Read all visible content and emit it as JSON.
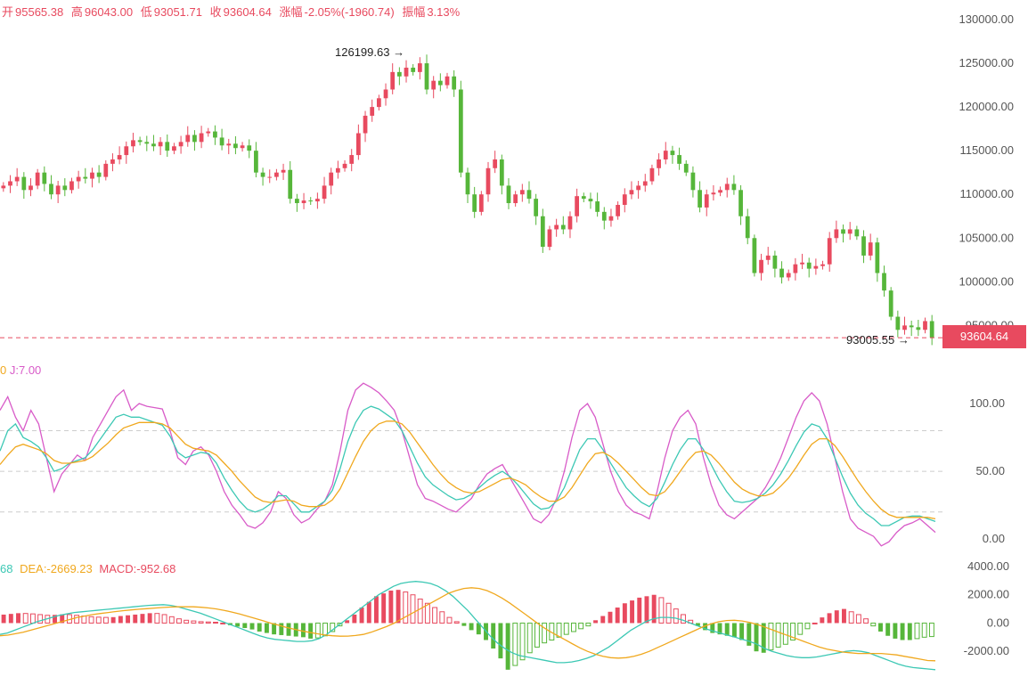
{
  "header": {
    "open_label": "开",
    "open": "95565.38",
    "high_label": "高",
    "high": "96043.00",
    "low_label": "低",
    "low": "93051.71",
    "close_label": "收",
    "close": "93604.64",
    "change_label": "涨幅",
    "change": "-2.05%(-1960.74)",
    "amp_label": "振幅",
    "amp": "3.13%"
  },
  "annotations": {
    "max": "126199.63 →",
    "min": "93005.55 →"
  },
  "price_tag": "93604.64",
  "kdj_legend": {
    "j": "J:7.00"
  },
  "macd_legend": {
    "dif_tail": "68",
    "dea": "DEA:-2669.23",
    "macd": "MACD:-952.68"
  },
  "colors": {
    "up": "#e84a5f",
    "down": "#56b63a",
    "k": "#3cc8b4",
    "d": "#f0a81e",
    "j": "#d85bc8",
    "grid": "#cccccc"
  },
  "chart_data": [
    {
      "type": "candlestick",
      "title": "",
      "ylim": [
        93000,
        130000
      ],
      "y_ticks": [
        "130000.00",
        "125000.00",
        "120000.00",
        "115000.00",
        "110000.00",
        "105000.00",
        "100000.00",
        "95000.00"
      ],
      "last_price": 93604.64,
      "max_label": 126199.63,
      "min_label": 93005.55,
      "close_series": [
        111000,
        111500,
        112000,
        110500,
        111000,
        112500,
        111200,
        110000,
        111000,
        110500,
        111500,
        112000,
        111800,
        112500,
        112000,
        113500,
        114000,
        114500,
        115500,
        116200,
        116000,
        115800,
        115500,
        116000,
        115000,
        115500,
        116000,
        116800,
        116000,
        117000,
        117200,
        116500,
        115600,
        115800,
        115300,
        115600,
        115000,
        112500,
        112000,
        112000,
        112500,
        112800,
        109500,
        109000,
        109300,
        109200,
        109500,
        111000,
        112500,
        113000,
        113500,
        114500,
        117000,
        119000,
        120000,
        121000,
        122000,
        124000,
        123500,
        124500,
        124000,
        125000,
        122000,
        123000,
        122500,
        123500,
        122000,
        112500,
        110000,
        108000,
        110000,
        113000,
        114000,
        111000,
        109000,
        110000,
        110500,
        109500,
        107500,
        104000,
        106000,
        106500,
        106000,
        107500,
        109800,
        109500,
        109200,
        108000,
        107000,
        107500,
        108800,
        110000,
        110500,
        111000,
        111500,
        113000,
        114000,
        115000,
        114500,
        113500,
        112500,
        110500,
        108500,
        110000,
        110200,
        110500,
        111200,
        110500,
        107500,
        105000,
        101000,
        102500,
        103000,
        101500,
        100500,
        101000,
        102000,
        102200,
        101500,
        101800,
        102000,
        105000,
        106000,
        105500,
        106000,
        105200,
        103000,
        104500,
        101000,
        99000,
        96000,
        94500,
        95000,
        94800,
        94500,
        95500,
        93604.64
      ]
    },
    {
      "type": "line",
      "title": "KDJ",
      "ylim": [
        -15,
        125
      ],
      "y_ticks": [
        "100.00",
        "50.00",
        "0.00"
      ],
      "reference_lines": [
        80,
        50,
        20
      ],
      "series": [
        {
          "name": "J",
          "values": [
            95,
            105,
            90,
            80,
            95,
            85,
            60,
            35,
            48,
            55,
            62,
            58,
            75,
            85,
            95,
            105,
            110,
            95,
            100,
            98,
            97,
            96,
            80,
            60,
            55,
            65,
            68,
            62,
            50,
            35,
            25,
            18,
            10,
            8,
            12,
            20,
            35,
            30,
            18,
            12,
            15,
            22,
            28,
            40,
            65,
            95,
            110,
            115,
            112,
            108,
            102,
            95,
            80,
            60,
            40,
            30,
            28,
            25,
            22,
            20,
            25,
            30,
            40,
            48,
            52,
            55,
            45,
            35,
            25,
            15,
            12,
            18,
            30,
            50,
            75,
            95,
            100,
            90,
            70,
            50,
            35,
            25,
            20,
            18,
            15,
            35,
            60,
            80,
            90,
            95,
            85,
            60,
            40,
            25,
            18,
            15,
            20,
            25,
            30,
            38,
            48,
            60,
            75,
            90,
            102,
            108,
            102,
            85,
            60,
            35,
            15,
            8,
            5,
            2,
            -5,
            -2,
            5,
            10,
            12,
            15,
            10,
            5
          ]
        },
        {
          "name": "K",
          "values": [
            65,
            80,
            85,
            75,
            72,
            68,
            60,
            50,
            52,
            56,
            58,
            60,
            66,
            74,
            82,
            90,
            92,
            90,
            90,
            88,
            86,
            84,
            76,
            64,
            60,
            62,
            64,
            63,
            56,
            45,
            36,
            28,
            22,
            20,
            22,
            26,
            32,
            32,
            26,
            20,
            20,
            24,
            28,
            36,
            52,
            72,
            86,
            95,
            98,
            96,
            92,
            88,
            80,
            68,
            56,
            46,
            40,
            36,
            32,
            29,
            30,
            33,
            38,
            43,
            47,
            50,
            46,
            40,
            33,
            26,
            22,
            23,
            28,
            38,
            52,
            66,
            74,
            74,
            66,
            56,
            47,
            38,
            32,
            27,
            24,
            30,
            42,
            55,
            66,
            74,
            74,
            66,
            55,
            44,
            35,
            28,
            27,
            28,
            30,
            34,
            40,
            48,
            58,
            69,
            79,
            85,
            83,
            74,
            60,
            46,
            34,
            25,
            19,
            15,
            10,
            10,
            13,
            16,
            17,
            17,
            15,
            13
          ]
        },
        {
          "name": "D",
          "values": [
            55,
            62,
            68,
            70,
            68,
            66,
            63,
            58,
            56,
            56,
            57,
            58,
            61,
            66,
            71,
            77,
            82,
            84,
            86,
            86,
            86,
            85,
            82,
            76,
            70,
            67,
            66,
            65,
            62,
            56,
            50,
            43,
            37,
            31,
            28,
            27,
            28,
            29,
            28,
            25,
            24,
            24,
            25,
            29,
            37,
            49,
            61,
            72,
            80,
            85,
            87,
            87,
            85,
            79,
            71,
            63,
            55,
            48,
            42,
            38,
            35,
            34,
            35,
            38,
            41,
            44,
            45,
            43,
            40,
            35,
            31,
            28,
            28,
            31,
            38,
            47,
            56,
            63,
            64,
            61,
            56,
            50,
            44,
            38,
            33,
            32,
            35,
            42,
            50,
            58,
            64,
            65,
            62,
            56,
            49,
            42,
            37,
            34,
            32,
            32,
            34,
            39,
            45,
            53,
            62,
            70,
            74,
            74,
            69,
            61,
            52,
            43,
            35,
            28,
            22,
            18,
            16,
            16,
            16,
            16,
            16,
            15
          ]
        }
      ]
    },
    {
      "type": "bar+line",
      "title": "MACD",
      "ylim": [
        -3500,
        4000
      ],
      "y_ticks": [
        "4000.00",
        "2000.00",
        "0.00",
        "-2000.00"
      ],
      "series": [
        {
          "name": "MACD",
          "values": [
            600,
            650,
            700,
            680,
            650,
            600,
            550,
            580,
            620,
            600,
            550,
            500,
            450,
            420,
            400,
            420,
            500,
            550,
            600,
            650,
            700,
            680,
            600,
            450,
            300,
            200,
            150,
            100,
            80,
            60,
            0,
            -150,
            -250,
            -350,
            -450,
            -600,
            -700,
            -800,
            -850,
            -900,
            -950,
            -1000,
            -1100,
            -1050,
            -900,
            -600,
            -200,
            200,
            600,
            1100,
            1500,
            1900,
            2100,
            2300,
            2350,
            2200,
            2000,
            1700,
            1400,
            1100,
            800,
            400,
            100,
            -200,
            -500,
            -800,
            -1200,
            -1800,
            -2500,
            -3300,
            -3000,
            -2600,
            -2100,
            -1700,
            -1400,
            -1200,
            -1000,
            -800,
            -600,
            -400,
            -200,
            200,
            500,
            800,
            1100,
            1400,
            1600,
            1800,
            1900,
            2000,
            1800,
            1400,
            1000,
            600,
            200,
            -200,
            -500,
            -700,
            -800,
            -900,
            -1000,
            -1200,
            -1600,
            -2000,
            -2100,
            -1900,
            -1700,
            -1500,
            -1200,
            -800,
            -400,
            0,
            400,
            700,
            900,
            1000,
            800,
            600,
            300,
            -200,
            -600,
            -900,
            -1100,
            -1200,
            -1200,
            -1100,
            -1000,
            -952.68
          ]
        },
        {
          "name": "DIF",
          "values": [
            -800,
            -700,
            -500,
            -300,
            -100,
            100,
            250,
            400,
            550,
            650,
            750,
            800,
            850,
            900,
            950,
            1000,
            1050,
            1100,
            1150,
            1200,
            1250,
            1280,
            1300,
            1250,
            1150,
            1000,
            850,
            700,
            500,
            300,
            100,
            -100,
            -300,
            -500,
            -700,
            -900,
            -1050,
            -1150,
            -1200,
            -1250,
            -1300,
            -1300,
            -1250,
            -1100,
            -800,
            -400,
            0,
            400,
            800,
            1200,
            1600,
            2000,
            2300,
            2600,
            2800,
            2900,
            2950,
            2900,
            2800,
            2600,
            2300,
            1900,
            1400,
            900,
            300,
            -300,
            -900,
            -1400,
            -1800,
            -2100,
            -2300,
            -2400,
            -2500,
            -2600,
            -2700,
            -2800,
            -2800,
            -2750,
            -2650,
            -2500,
            -2300,
            -2000,
            -1700,
            -1300,
            -900,
            -500,
            -200,
            100,
            300,
            400,
            400,
            350,
            200,
            0,
            -200,
            -400,
            -550,
            -700,
            -850,
            -1000,
            -1150,
            -1300,
            -1500,
            -1800,
            -2000,
            -2150,
            -2300,
            -2400,
            -2450,
            -2450,
            -2400,
            -2300,
            -2200,
            -2100,
            -2000,
            -1950,
            -2000,
            -2100,
            -2300,
            -2500,
            -2700,
            -2900,
            -3050,
            -3150,
            -3200,
            -3250,
            -3300
          ]
        },
        {
          "name": "DEA",
          "values": [
            -900,
            -850,
            -750,
            -650,
            -500,
            -350,
            -200,
            -50,
            100,
            250,
            400,
            500,
            600,
            680,
            750,
            820,
            880,
            930,
            980,
            1020,
            1060,
            1100,
            1130,
            1150,
            1160,
            1150,
            1120,
            1070,
            1000,
            900,
            780,
            640,
            490,
            330,
            170,
            0,
            -150,
            -300,
            -430,
            -550,
            -650,
            -750,
            -840,
            -900,
            -930,
            -920,
            -880,
            -800,
            -650,
            -450,
            -250,
            0,
            300,
            600,
            900,
            1200,
            1500,
            1800,
            2100,
            2300,
            2450,
            2500,
            2450,
            2300,
            2050,
            1750,
            1400,
            1000,
            600,
            200,
            -200,
            -550,
            -850,
            -1150,
            -1450,
            -1750,
            -2000,
            -2200,
            -2350,
            -2450,
            -2480,
            -2450,
            -2350,
            -2200,
            -2000,
            -1750,
            -1500,
            -1250,
            -1000,
            -750,
            -500,
            -250,
            -50,
            100,
            180,
            200,
            150,
            50,
            -100,
            -300,
            -500,
            -700,
            -900,
            -1100,
            -1300,
            -1500,
            -1700,
            -1850,
            -1950,
            -2050,
            -2100,
            -2150,
            -2150,
            -2150,
            -2150,
            -2200,
            -2250,
            -2350,
            -2450,
            -2550,
            -2650,
            -2669.23
          ]
        }
      ]
    }
  ]
}
